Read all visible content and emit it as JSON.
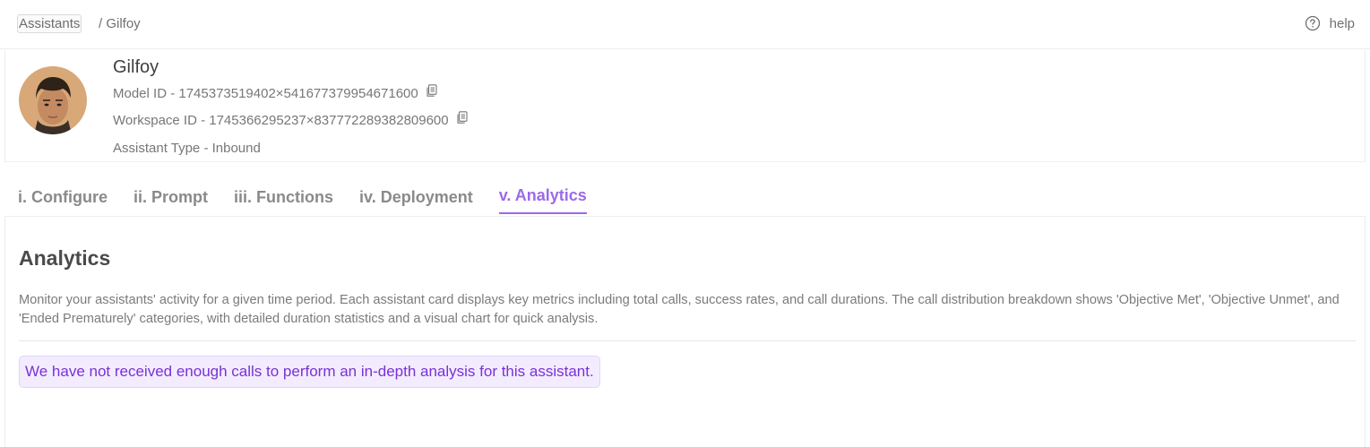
{
  "breadcrumb": {
    "root": "Assistants",
    "current": "/ Gilfoy"
  },
  "help": {
    "label": "help",
    "icon": "question-circle-icon"
  },
  "assistant": {
    "name": "Gilfoy",
    "model_id": "Model ID - 1745373519402×541677379954671600",
    "workspace_id": "Workspace ID - 1745366295237×837772289382809600",
    "type": "Assistant Type - Inbound"
  },
  "tabs": [
    {
      "label": "i. Configure",
      "active": false
    },
    {
      "label": "ii. Prompt",
      "active": false
    },
    {
      "label": "iii. Functions",
      "active": false
    },
    {
      "label": "iv. Deployment",
      "active": false
    },
    {
      "label": "v. Analytics",
      "active": true
    }
  ],
  "analytics": {
    "title": "Analytics",
    "description": "Monitor your assistants' activity for a given time period. Each assistant card displays key metrics including total calls, success rates, and call durations. The call distribution breakdown shows 'Objective Met', 'Objective Unmet', and 'Ended Prematurely' categories, with detailed duration statistics and a visual chart for quick analysis.",
    "notice": "We have not received enough calls to perform an in-depth analysis for this assistant."
  },
  "colors": {
    "accent": "#9b6ae8",
    "notice_text": "#7a32d6",
    "notice_bg": "#f3ecfe"
  }
}
